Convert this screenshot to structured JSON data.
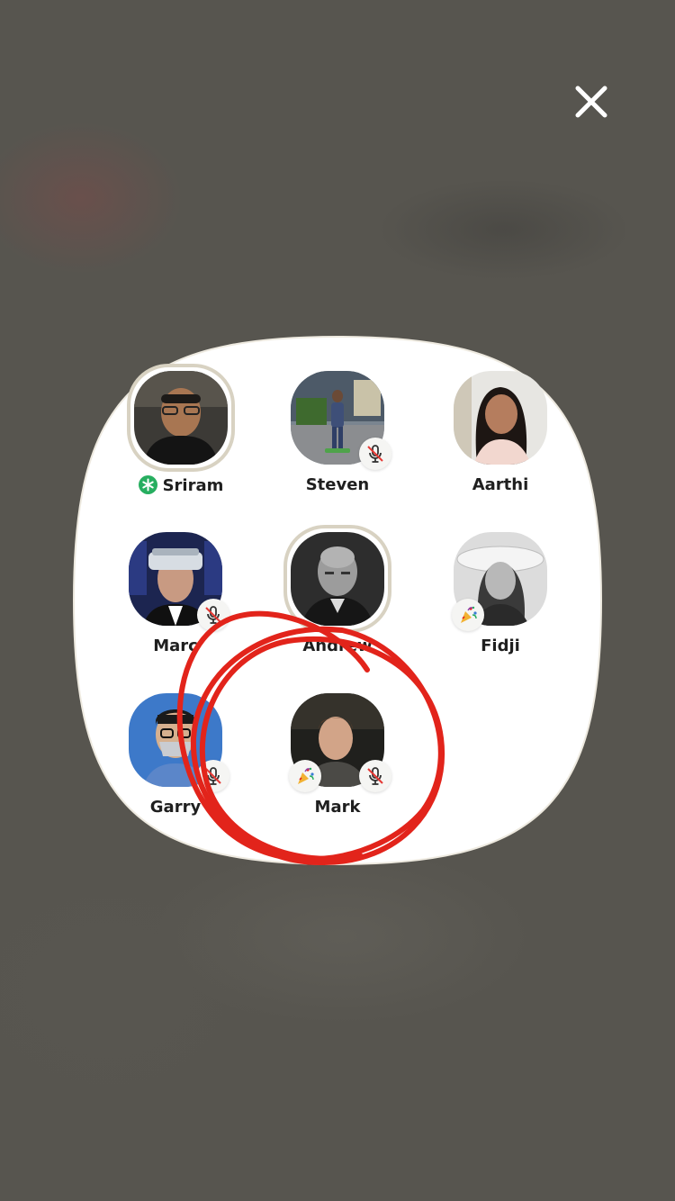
{
  "room": {
    "close_icon": "close-icon",
    "speakers": [
      {
        "name": "Sriram",
        "moderator": true,
        "muted": false,
        "party": false
      },
      {
        "name": "Steven",
        "moderator": false,
        "muted": true,
        "party": false
      },
      {
        "name": "Aarthi",
        "moderator": false,
        "muted": false,
        "party": false
      },
      {
        "name": "Marc",
        "moderator": false,
        "muted": true,
        "party": false
      },
      {
        "name": "Andrew",
        "moderator": false,
        "muted": false,
        "party": false
      },
      {
        "name": "Fidji",
        "moderator": false,
        "muted": false,
        "party": true
      },
      {
        "name": "Garry",
        "moderator": false,
        "muted": true,
        "party": false
      },
      {
        "name": "Mark",
        "moderator": false,
        "muted": true,
        "party": true
      }
    ]
  },
  "colors": {
    "overlay": "#57554f",
    "card": "#ffffff",
    "moderator_badge": "#27ae60",
    "annotation": "#e2241b"
  }
}
